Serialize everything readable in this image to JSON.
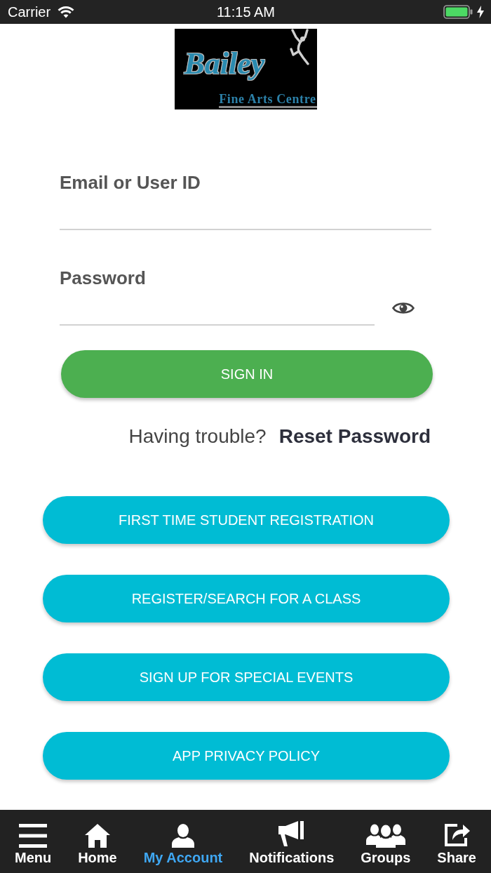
{
  "status_bar": {
    "carrier": "Carrier",
    "time": "11:15 AM",
    "charging": true
  },
  "logo": {
    "script": "Bailey",
    "subtitle": "Fine Arts Centre"
  },
  "form": {
    "fields": [
      {
        "label": "Email or User ID",
        "kind": "text"
      },
      {
        "label": "Password",
        "kind": "password"
      }
    ],
    "submit": "SIGN IN",
    "help": {
      "prompt": "Having trouble?",
      "link": "Reset Password"
    }
  },
  "actions": [
    "FIRST TIME STUDENT REGISTRATION",
    "REGISTER/SEARCH FOR A CLASS",
    "SIGN UP FOR SPECIAL EVENTS",
    "APP PRIVACY POLICY"
  ],
  "tab_bar": [
    {
      "label": "Menu",
      "kind": "menu",
      "selected": false
    },
    {
      "label": "Home",
      "kind": "home",
      "selected": false
    },
    {
      "label": "My Account",
      "kind": "account",
      "selected": true
    },
    {
      "label": "Notifications",
      "kind": "notifications",
      "selected": false
    },
    {
      "label": "Groups",
      "kind": "groups",
      "selected": false
    },
    {
      "label": "Share",
      "kind": "share",
      "selected": false
    }
  ]
}
